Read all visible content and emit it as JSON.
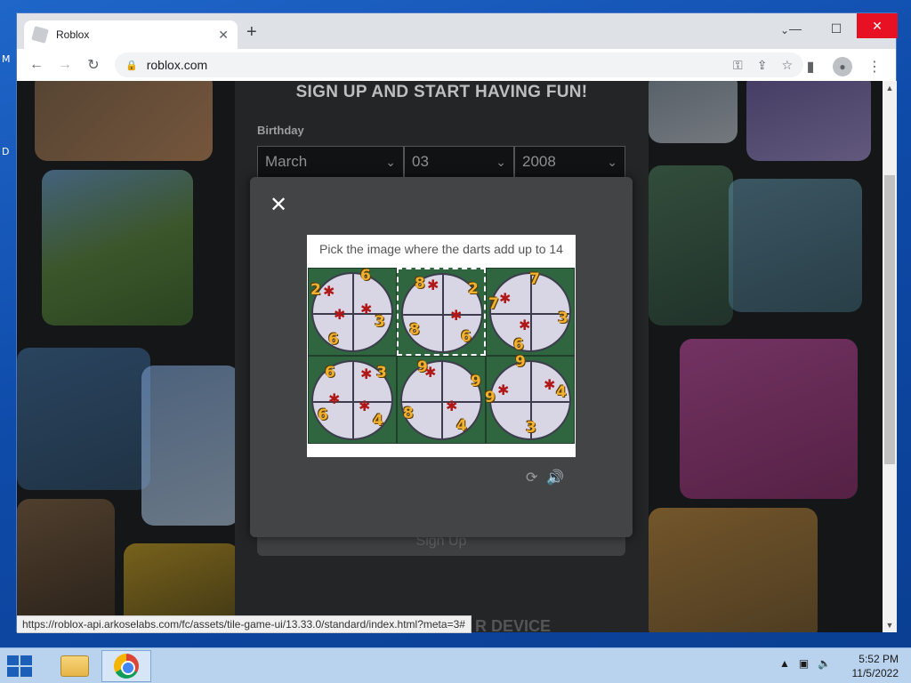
{
  "desktop": {
    "glyph_top": "M",
    "glyph_mid": "D"
  },
  "browser": {
    "tab": {
      "title": "Roblox",
      "close": "✕"
    },
    "new_tab": "+",
    "tab_search": "⌄",
    "window": {
      "minimize": "—",
      "maximize": "☐",
      "close": "✕"
    },
    "nav": {
      "back": "←",
      "forward": "→",
      "reload": "↻"
    },
    "address": {
      "lock": "🔒",
      "url": "roblox.com"
    },
    "omni_icons": {
      "key": "⚿",
      "share": "⇪",
      "star": "☆"
    },
    "toolbar_right": {
      "sidepanel": "▮",
      "profile": "●",
      "menu": "⋮"
    },
    "status_url": "https://roblox-api.arkoselabs.com/fc/assets/tile-game-ui/13.33.0/standard/index.html?meta=3#"
  },
  "page": {
    "signup_title": "SIGN UP AND START HAVING FUN!",
    "birthday_label": "Birthday",
    "month": "March",
    "day": "03",
    "year": "2008",
    "signup_button": "Sign Up",
    "device_text": "R DEVICE"
  },
  "captcha": {
    "close": "✕",
    "prompt": "Pick the image where the darts add up to 14",
    "reload_icon": "⟳",
    "audio_icon": "🔊",
    "cells": [
      {
        "numbers": [
          "2",
          "6",
          "3",
          "6"
        ],
        "selected": false
      },
      {
        "numbers": [
          "8",
          "2",
          "8",
          "6"
        ],
        "selected": true
      },
      {
        "numbers": [
          "7",
          "7",
          "3",
          "6"
        ],
        "selected": false
      },
      {
        "numbers": [
          "6",
          "3",
          "6",
          "4"
        ],
        "selected": false
      },
      {
        "numbers": [
          "9",
          "9",
          "8",
          "4"
        ],
        "selected": false
      },
      {
        "numbers": [
          "9",
          "9",
          "4",
          "3"
        ],
        "selected": false
      }
    ]
  },
  "taskbar": {
    "time": "5:52 PM",
    "date": "11/5/2022",
    "tray_up": "▲",
    "network": "▣",
    "volume": "🔈"
  }
}
